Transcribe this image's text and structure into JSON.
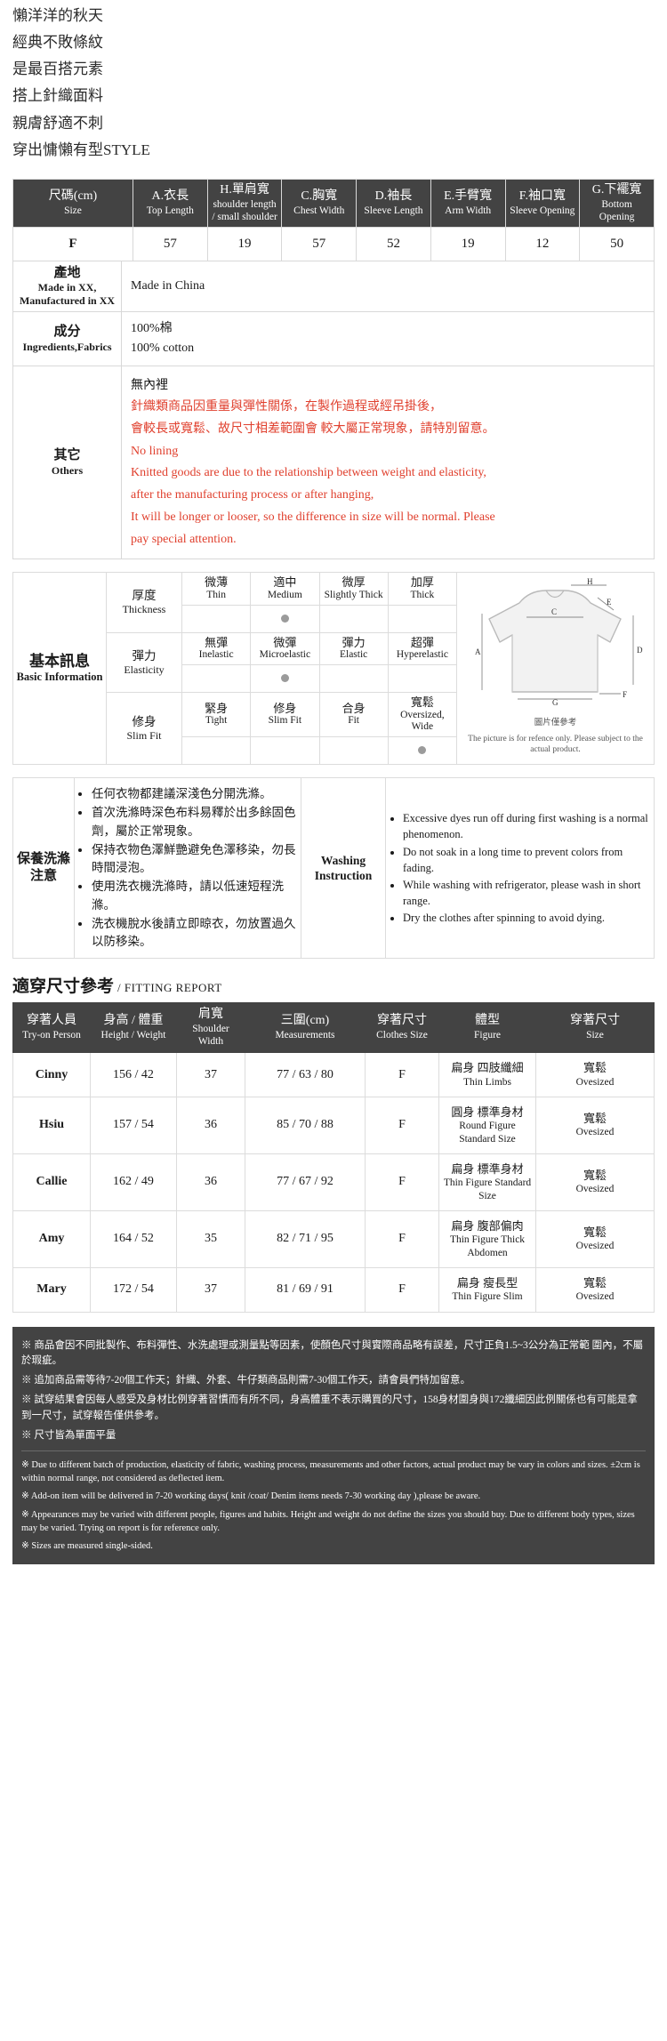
{
  "intro": {
    "lines": [
      "懶洋洋的秋天",
      "經典不敗條紋",
      "是最百搭元素",
      "搭上針織面料",
      "親膚舒適不刺",
      "穿出慵懶有型STYLE"
    ]
  },
  "size_chart": {
    "headers": [
      {
        "cn": "尺碼(cm)",
        "en": "Size"
      },
      {
        "cn": "A.衣長",
        "en": "Top Length"
      },
      {
        "cn": "H.單肩寬",
        "en": "shoulder length / small shoulder"
      },
      {
        "cn": "C.胸寬",
        "en": "Chest Width"
      },
      {
        "cn": "D.袖長",
        "en": "Sleeve Length"
      },
      {
        "cn": "E.手臂寬",
        "en": "Arm Width"
      },
      {
        "cn": "F.袖口寬",
        "en": "Sleeve Opening"
      },
      {
        "cn": "G.下襬寬",
        "en": "Bottom Opening"
      }
    ],
    "rows": [
      {
        "size": "F",
        "values": [
          "57",
          "19",
          "57",
          "52",
          "19",
          "12",
          "50"
        ]
      }
    ]
  },
  "info": {
    "origin": {
      "label_cn": "產地",
      "label_en": "Made in XX, Manufactured in XX",
      "value": "Made in China"
    },
    "fabric": {
      "label_cn": "成分",
      "label_en": "Ingredients,Fabrics",
      "value_cn": "100%棉",
      "value_en": "100% cotton"
    },
    "others": {
      "label_cn": "其它",
      "label_en": "Others",
      "lining_cn": "無內裡",
      "red_cn_1": "針織類商品因重量與彈性關係，在製作過程或經吊掛後，",
      "red_cn_2": "會較長或寬鬆、故尺寸相差範圍會 較大屬正常現象，請特別留意。",
      "red_en_1": "No lining",
      "red_en_2": "Knitted goods are due to the relationship between weight and elasticity,",
      "red_en_3": "after the manufacturing process or after hanging,",
      "red_en_4": "It will be longer or looser, so the difference in size will be normal. Please",
      "red_en_5": "pay special attention."
    }
  },
  "basic": {
    "label_cn": "基本訊息",
    "label_en": "Basic Information",
    "attrs": [
      {
        "label_cn": "厚度",
        "label_en": "Thickness",
        "options": [
          {
            "cn": "微薄",
            "en": "Thin"
          },
          {
            "cn": "適中",
            "en": "Medium"
          },
          {
            "cn": "微厚",
            "en": "Slightly Thick"
          },
          {
            "cn": "加厚",
            "en": "Thick"
          }
        ],
        "selected": 1
      },
      {
        "label_cn": "彈力",
        "label_en": "Elasticity",
        "options": [
          {
            "cn": "無彈",
            "en": "Inelastic"
          },
          {
            "cn": "微彈",
            "en": "Microelastic"
          },
          {
            "cn": "彈力",
            "en": "Elastic"
          },
          {
            "cn": "超彈",
            "en": "Hyperelastic"
          }
        ],
        "selected": 1
      },
      {
        "label_cn": "修身",
        "label_en": "Slim Fit",
        "options": [
          {
            "cn": "緊身",
            "en": "Tight"
          },
          {
            "cn": "修身",
            "en": "Slim Fit"
          },
          {
            "cn": "合身",
            "en": "Fit"
          },
          {
            "cn": "寬鬆",
            "en": "Oversized, Wide"
          }
        ],
        "selected": 3
      }
    ],
    "figure_caption_cn": "圖片僅參考",
    "figure_caption_en": "The picture is for refence only. Please subject to the actual product.",
    "figure_labels": [
      "A",
      "C",
      "D",
      "E",
      "F",
      "G",
      "H"
    ]
  },
  "washing": {
    "label_cn": "保養洗滌注意",
    "label_en": "",
    "instruction_label": "Washing Instruction",
    "items_cn": [
      "任何衣物都建議深淺色分開洗滌。",
      "首次洗滌時深色布料易釋於出多餘固色劑，屬於正常現象。",
      "保持衣物色澤鮮艷避免色澤移染，勿長時間浸泡。",
      "使用洗衣機洗滌時，請以低速短程洗滌。",
      "洗衣機脫水後請立即晾衣，勿放置過久以防移染。"
    ],
    "items_en": [
      "Excessive dyes run off during first washing is a normal phenomenon.",
      "Do not soak in a long time to prevent colors from fading.",
      "While washing with refrigerator, please wash in short range.",
      "Dry the clothes after spinning to avoid dying."
    ]
  },
  "fitting": {
    "title_cn": "適穿尺寸參考",
    "title_en": "/ FITTING REPORT",
    "headers": [
      {
        "cn": "穿著人員",
        "en": "Try-on Person"
      },
      {
        "cn": "身高 / 體重",
        "en": "Height / Weight"
      },
      {
        "cn": "肩寬",
        "en": "Shoulder Width"
      },
      {
        "cn": "三圍(cm)",
        "en": "Measurements"
      },
      {
        "cn": "穿著尺寸",
        "en": "Clothes Size"
      },
      {
        "cn": "體型",
        "en": "Figure"
      },
      {
        "cn": "穿著尺寸",
        "en": "Size"
      }
    ],
    "rows": [
      {
        "name": "Cinny",
        "hw": "156 / 42",
        "shoulder": "37",
        "measure": "77 / 63 / 80",
        "size": "F",
        "figure_cn": "扁身 四肢纖細",
        "figure_en": "Thin Limbs",
        "wear_cn": "寬鬆",
        "wear_en": "Ovesized"
      },
      {
        "name": "Hsiu",
        "hw": "157 / 54",
        "shoulder": "36",
        "measure": "85 / 70 / 88",
        "size": "F",
        "figure_cn": "圓身 標準身材",
        "figure_en": "Round Figure Standard Size",
        "wear_cn": "寬鬆",
        "wear_en": "Ovesized"
      },
      {
        "name": "Callie",
        "hw": "162 / 49",
        "shoulder": "36",
        "measure": "77 / 67 / 92",
        "size": "F",
        "figure_cn": "扁身 標準身材",
        "figure_en": "Thin Figure Standard Size",
        "wear_cn": "寬鬆",
        "wear_en": "Ovesized"
      },
      {
        "name": "Amy",
        "hw": "164 / 52",
        "shoulder": "35",
        "measure": "82 / 71 / 95",
        "size": "F",
        "figure_cn": "扁身 腹部偏肉",
        "figure_en": "Thin Figure Thick Abdomen",
        "wear_cn": "寬鬆",
        "wear_en": "Ovesized"
      },
      {
        "name": "Mary",
        "hw": "172 / 54",
        "shoulder": "37",
        "measure": "81 / 69 / 91",
        "size": "F",
        "figure_cn": "扁身 瘦長型",
        "figure_en": "Thin Figure Slim",
        "wear_cn": "寬鬆",
        "wear_en": "Ovesized"
      }
    ]
  },
  "footer": {
    "notes_cn": [
      "※ 商品會因不同批製作、布料彈性、水洗處理或測量點等因素，使顏色尺寸與實際商品略有誤差，尺寸正負1.5~3公分為正常範 圍內，不屬於瑕疵。",
      "※ 追加商品需等待7-20個工作天；針織、外套、牛仔類商品則需7-30個工作天，請會員們特加留意。",
      "※ 試穿結果會因每人感受及身材比例穿著習慣而有所不同，身高體重不表示購買的尺寸，158身材圍身與172纖細因此例關係也有可能是拿到一尺寸，試穿報告僅供參考。",
      "※ 尺寸皆為單面平量"
    ],
    "notes_en": [
      "※ Due to different batch of production, elasticity of fabric, washing process, measurements and other factors, actual product may be vary in colors and sizes. ±2cm is within normal range, not considered as deflected item.",
      "※ Add-on item will be delivered in 7-20 working days( knit /coat/ Denim items needs 7-30 working day ),please be aware.",
      "※ Appearances may be varied with different people, figures and habits. Height and weight do not define the sizes you should buy. Due to different body types, sizes may be varied. Trying on report is for reference only.",
      "※ Sizes are measured single-sided."
    ]
  }
}
